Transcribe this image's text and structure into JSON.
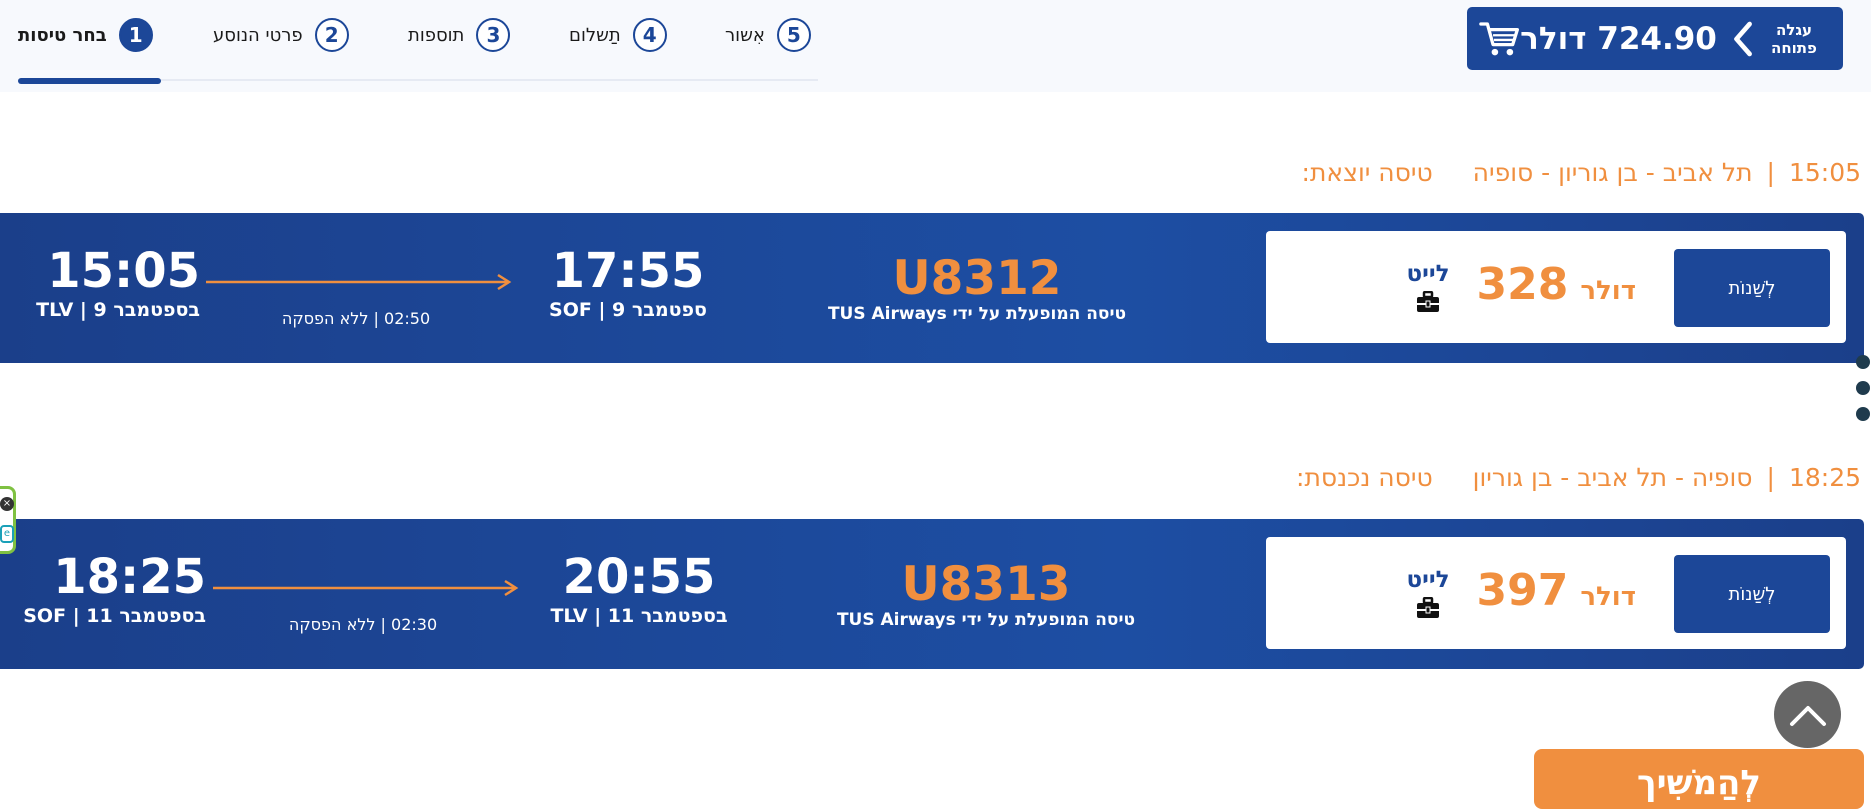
{
  "cart": {
    "label_line1": "עגלה",
    "label_line2": "פתוחה",
    "total": "724.90 דולר",
    "icon": "shopping-cart-icon"
  },
  "steps": [
    {
      "num": "1",
      "label": "בחר טיסות",
      "active": true
    },
    {
      "num": "2",
      "label": "פרטי הנוסע",
      "active": false
    },
    {
      "num": "3",
      "label": "תוספות",
      "active": false
    },
    {
      "num": "4",
      "label": "תַשלום",
      "active": false
    },
    {
      "num": "5",
      "label": "אִשור",
      "active": false
    }
  ],
  "flights": [
    {
      "heading_time": "15:05",
      "heading_route": "תל אביב - בן גוריון - סופיה",
      "heading_type": "טיסה יוצאת:",
      "change_label": "לְשַׁנוֹת",
      "price_currency": "דולר",
      "price_amount": "328",
      "fare_name": "לייט",
      "flight_number": "U8312",
      "operated_by": "טיסה המופעלת על ידי TUS Airways",
      "arrival_time": "17:55",
      "arrival_sub": "ספטמבר 9 | SOF",
      "departure_time": "15:05",
      "departure_sub": "בספטמבר 9 | TLV",
      "duration": "02:50 | ללא הפסקה"
    },
    {
      "heading_time": "18:25",
      "heading_route": "סופיה - תל אביב - בן גוריון",
      "heading_type": "טיסה נכנסת:",
      "change_label": "לְשַׁנוֹת",
      "price_currency": "דולר",
      "price_amount": "397",
      "fare_name": "לייט",
      "flight_number": "U8313",
      "operated_by": "טיסה המופעלת על ידי TUS Airways",
      "arrival_time": "20:55",
      "arrival_sub": "בספטמבר 11 | TLV",
      "departure_time": "18:25",
      "departure_sub": "בספטמבר 11 | SOF",
      "duration": "02:30 | ללא הפסקה"
    }
  ],
  "continue_label": "לְהַמשִׁיך",
  "colors": {
    "brand_blue": "#1c4798",
    "accent_orange": "#f08f3f"
  }
}
